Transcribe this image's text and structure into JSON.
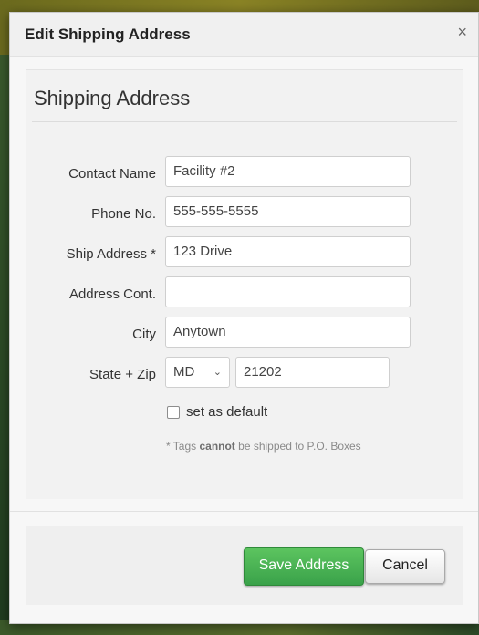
{
  "dialog": {
    "title": "Edit Shipping Address",
    "close_label": "×"
  },
  "section": {
    "title": "Shipping Address"
  },
  "fields": {
    "contact_name": {
      "label": "Contact Name",
      "value": "Facility #2"
    },
    "phone": {
      "label": "Phone No.",
      "value": "555-555-5555"
    },
    "ship_address": {
      "label": "Ship Address *",
      "value": "123 Drive"
    },
    "address_cont": {
      "label": "Address Cont.",
      "value": ""
    },
    "city": {
      "label": "City",
      "value": "Anytown"
    },
    "state_zip": {
      "label": "State + Zip",
      "state": "MD",
      "zip": "21202"
    }
  },
  "default_checkbox": {
    "label": "set as default"
  },
  "note": {
    "prefix": "* Tags ",
    "bold": "cannot",
    "suffix": " be shipped to P.O. Boxes"
  },
  "footer": {
    "save_label": "Save Address",
    "cancel_label": "Cancel"
  },
  "icons": {
    "close": "close-icon",
    "select_chevron": "chevron-down-icon",
    "checkbox": "checkbox-unchecked"
  }
}
